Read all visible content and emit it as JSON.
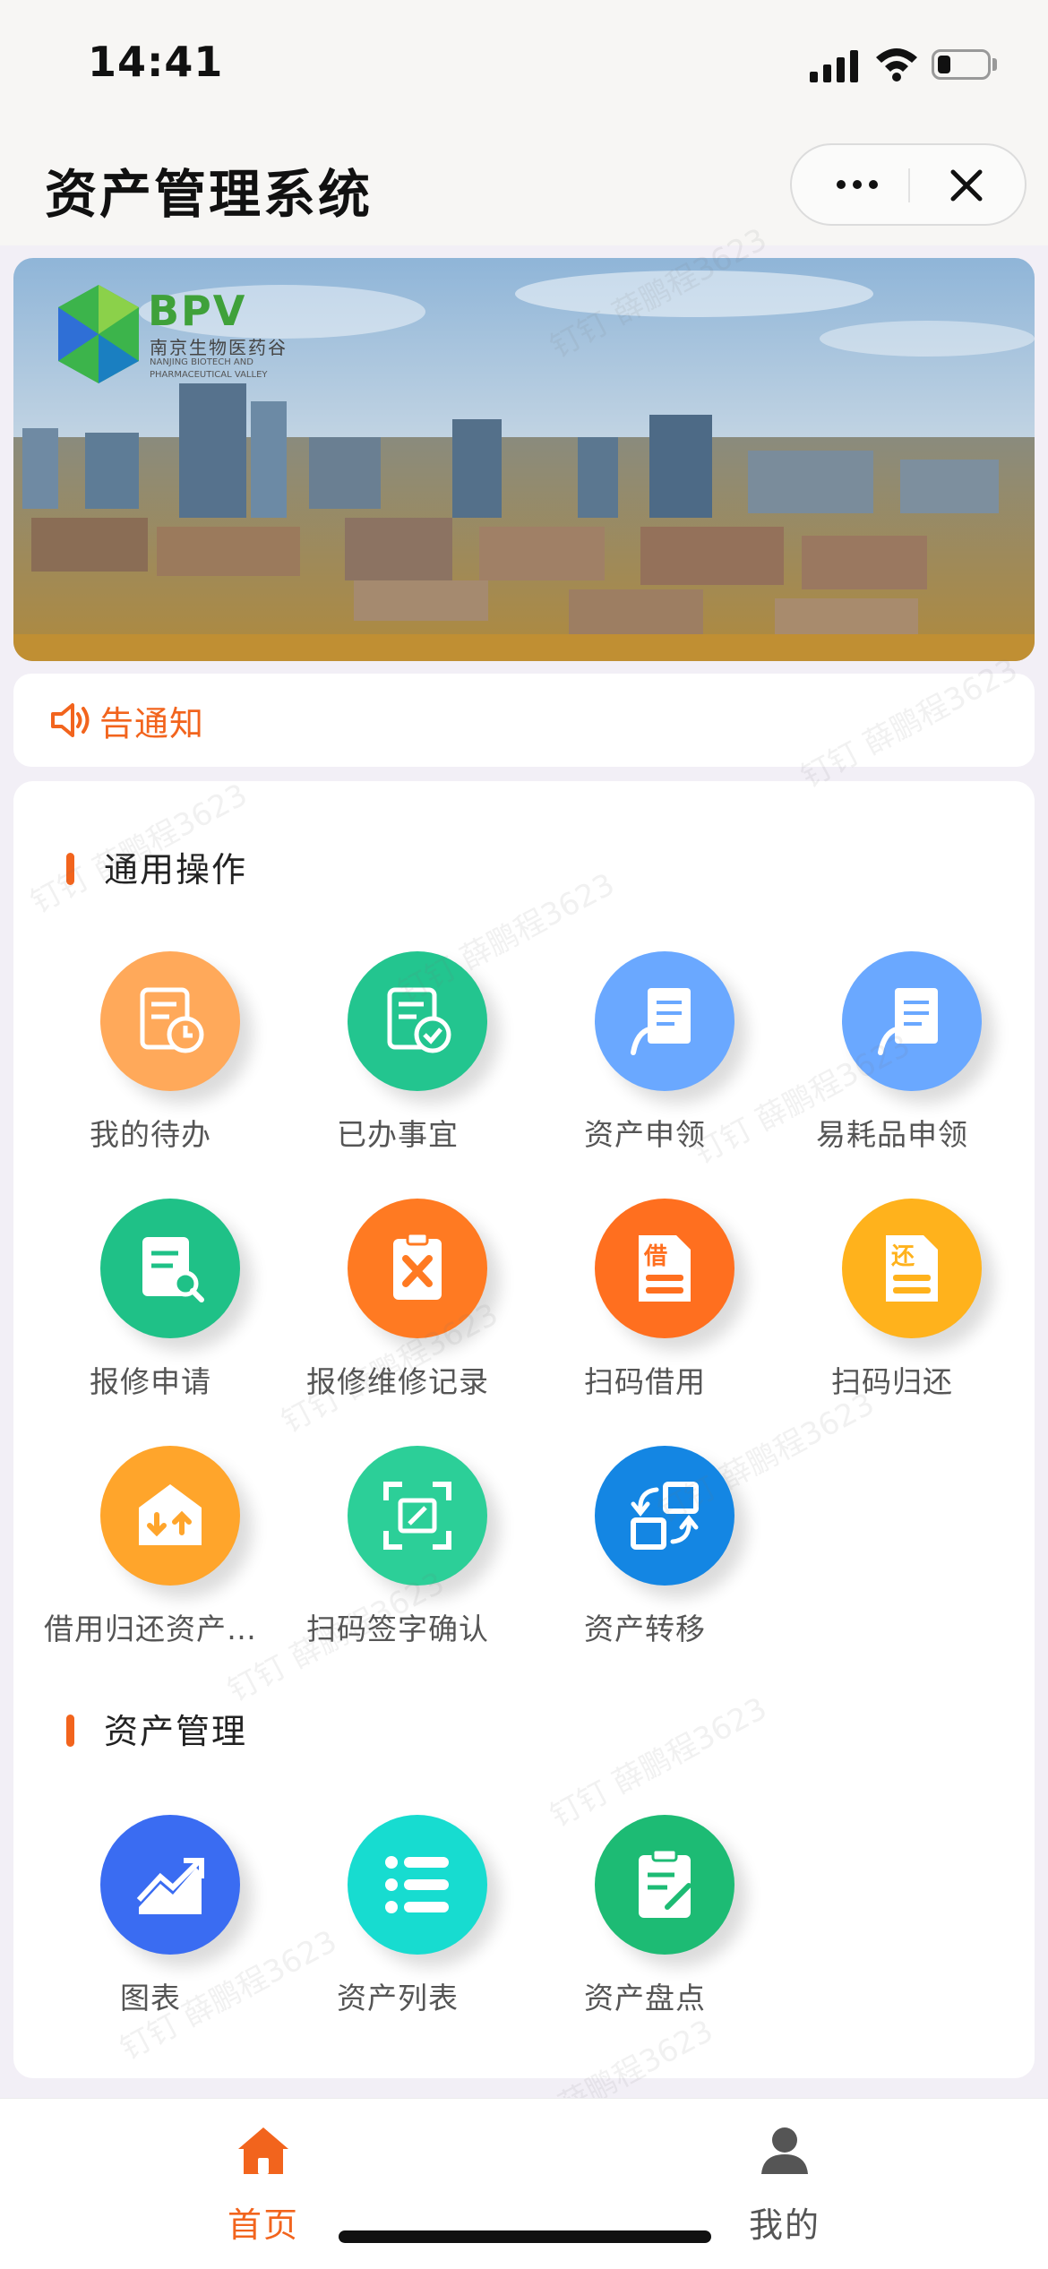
{
  "status_bar": {
    "time": "14:41",
    "battery_level": 0.24
  },
  "header": {
    "title": "资产管理系统"
  },
  "banner": {
    "brand": "BPV",
    "brand_cn": "南京生物医药谷",
    "brand_en": "NANJING BIOTECH AND PHARMACEUTICAL VALLEY"
  },
  "notice": {
    "text": "告通知"
  },
  "sections": {
    "common": {
      "title": "通用操作",
      "items": [
        {
          "label": "我的待办",
          "icon": "clock-doc-icon",
          "color": "#ffa95a"
        },
        {
          "label": "已办事宜",
          "icon": "check-doc-icon",
          "color": "#23c58f"
        },
        {
          "label": "资产申领",
          "icon": "hand-doc-icon",
          "color": "#6aa8ff"
        },
        {
          "label": "易耗品申领",
          "icon": "hand-doc-icon",
          "color": "#6aa8ff"
        },
        {
          "label": "报修申请",
          "icon": "search-doc-icon",
          "color": "#1fc187"
        },
        {
          "label": "报修维修记录",
          "icon": "repair-clipboard-icon",
          "color": "#ff7a22"
        },
        {
          "label": "扫码借用",
          "icon": "borrow-doc-icon",
          "color": "#ff6f1f",
          "glyph": "借"
        },
        {
          "label": "扫码归还",
          "icon": "return-doc-icon",
          "color": "#ffb21c",
          "glyph": "还"
        },
        {
          "label": "借用归还资产…",
          "icon": "box-transfer-icon",
          "color": "#ffa52b"
        },
        {
          "label": "扫码签字确认",
          "icon": "scan-sign-icon",
          "color": "#2ccf98"
        },
        {
          "label": "资产转移",
          "icon": "transfer-icon",
          "color": "#1486e3"
        }
      ]
    },
    "asset": {
      "title": "资产管理",
      "items": [
        {
          "label": "图表",
          "icon": "chart-icon",
          "color": "#3a6cf2"
        },
        {
          "label": "资产列表",
          "icon": "list-icon",
          "color": "#17dcd0"
        },
        {
          "label": "资产盘点",
          "icon": "inventory-icon",
          "color": "#1dbb74"
        }
      ]
    }
  },
  "tabbar": {
    "home": {
      "label": "首页",
      "color": "#f2641d"
    },
    "mine": {
      "label": "我的",
      "color": "#555555"
    }
  },
  "watermark": {
    "text": "钉钉 薛鹏程3623"
  }
}
